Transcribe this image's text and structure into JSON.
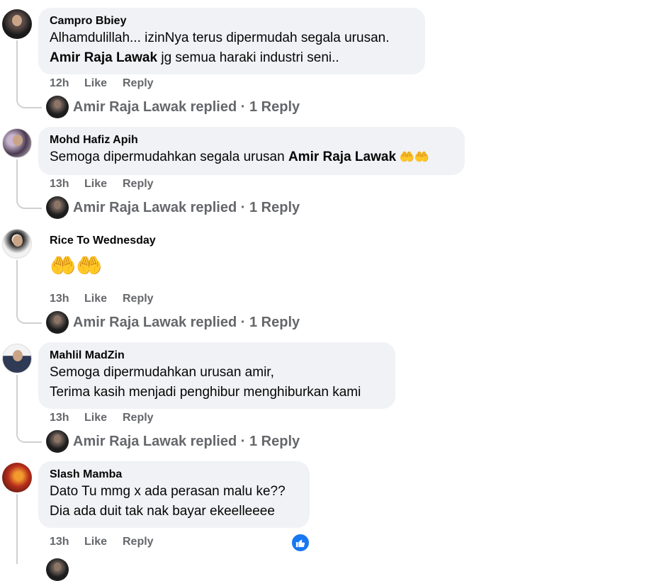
{
  "comments": [
    {
      "author": "Campro Bbiey",
      "line1": "Alhamdulillah... izinNya terus dipermudah segala urusan.",
      "line2_bold": "Amir Raja Lawak",
      "line2_rest": " jg semua haraki industri seni..",
      "time": "12h",
      "like": "Like",
      "reply": "Reply",
      "replies": "Amir Raja Lawak replied · 1 Reply"
    },
    {
      "author": "Mohd Hafiz Apih",
      "line1_pre": "Semoga dipermudahkan segala urusan ",
      "line1_bold": "Amir Raja Lawak",
      "line1_emoji": " 🤲🤲",
      "time": "13h",
      "like": "Like",
      "reply": "Reply",
      "replies": "Amir Raja Lawak replied · 1 Reply"
    },
    {
      "author": "Rice To Wednesday",
      "emoji": "🤲🤲",
      "time": "13h",
      "like": "Like",
      "reply": "Reply",
      "replies": "Amir Raja Lawak replied · 1 Reply"
    },
    {
      "author": "Mahlil MadZin",
      "line1": "Semoga dipermudahkan urusan amir,",
      "line2": "Terima kasih menjadi penghibur menghiburkan kami",
      "time": "13h",
      "like": "Like",
      "reply": "Reply",
      "replies": "Amir Raja Lawak replied · 1 Reply"
    },
    {
      "author": "Slash Mamba",
      "line1": "Dato Tu mmg x ada perasan malu ke??",
      "line2": "Dia ada duit tak nak bayar ekeelleeee",
      "time": "13h",
      "like": "Like",
      "reply": "Reply",
      "reaction_icon": "thumbs-up-icon"
    }
  ],
  "colors": {
    "bubble": "#f0f2f5",
    "meta": "#65676b",
    "accent": "#1877f2"
  }
}
